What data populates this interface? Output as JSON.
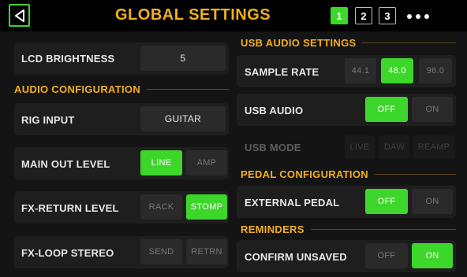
{
  "header": {
    "title": "GLOBAL SETTINGS",
    "pages": [
      "1",
      "2",
      "3"
    ],
    "active_page": "1"
  },
  "left": {
    "lcd_brightness": {
      "label": "LCD BRIGHTNESS",
      "value": "5"
    },
    "audio_configuration": "AUDIO CONFIGURATION",
    "rig_input": {
      "label": "RIG INPUT",
      "value": "GUITAR"
    },
    "main_out_level": {
      "label": "MAIN OUT LEVEL",
      "options": [
        "LINE",
        "AMP"
      ],
      "selected": "LINE"
    },
    "fx_return_level": {
      "label": "FX-RETURN LEVEL",
      "options": [
        "RACK",
        "STOMP"
      ],
      "selected": "STOMP"
    },
    "fx_loop_stereo": {
      "label": "FX-LOOP STEREO",
      "options": [
        "SEND",
        "RETRN"
      ],
      "selected": ""
    }
  },
  "right": {
    "usb_audio_settings": "USB AUDIO SETTINGS",
    "sample_rate": {
      "label": "SAMPLE RATE",
      "options": [
        "44.1",
        "48.0",
        "96.0"
      ],
      "selected": "48.0"
    },
    "usb_audio": {
      "label": "USB AUDIO",
      "options": [
        "OFF",
        "ON"
      ],
      "selected": "OFF"
    },
    "usb_mode": {
      "label": "USB MODE",
      "options": [
        "LIVE",
        "DAW",
        "REAMP"
      ]
    },
    "pedal_configuration": "PEDAL CONFIGURATION",
    "external_pedal": {
      "label": "EXTERNAL PEDAL",
      "options": [
        "OFF",
        "ON"
      ],
      "selected": "OFF"
    },
    "reminders": "REMINDERS",
    "confirm_unsaved": {
      "label": "CONFIRM UNSAVED",
      "options": [
        "OFF",
        "ON"
      ],
      "selected": "ON"
    }
  },
  "colors": {
    "accent_green": "#3dd62b",
    "section_orange": "#f2b01e",
    "background": "#141414"
  },
  "icons": {
    "back": "back-triangle-icon",
    "more": "more-dots-icon"
  }
}
